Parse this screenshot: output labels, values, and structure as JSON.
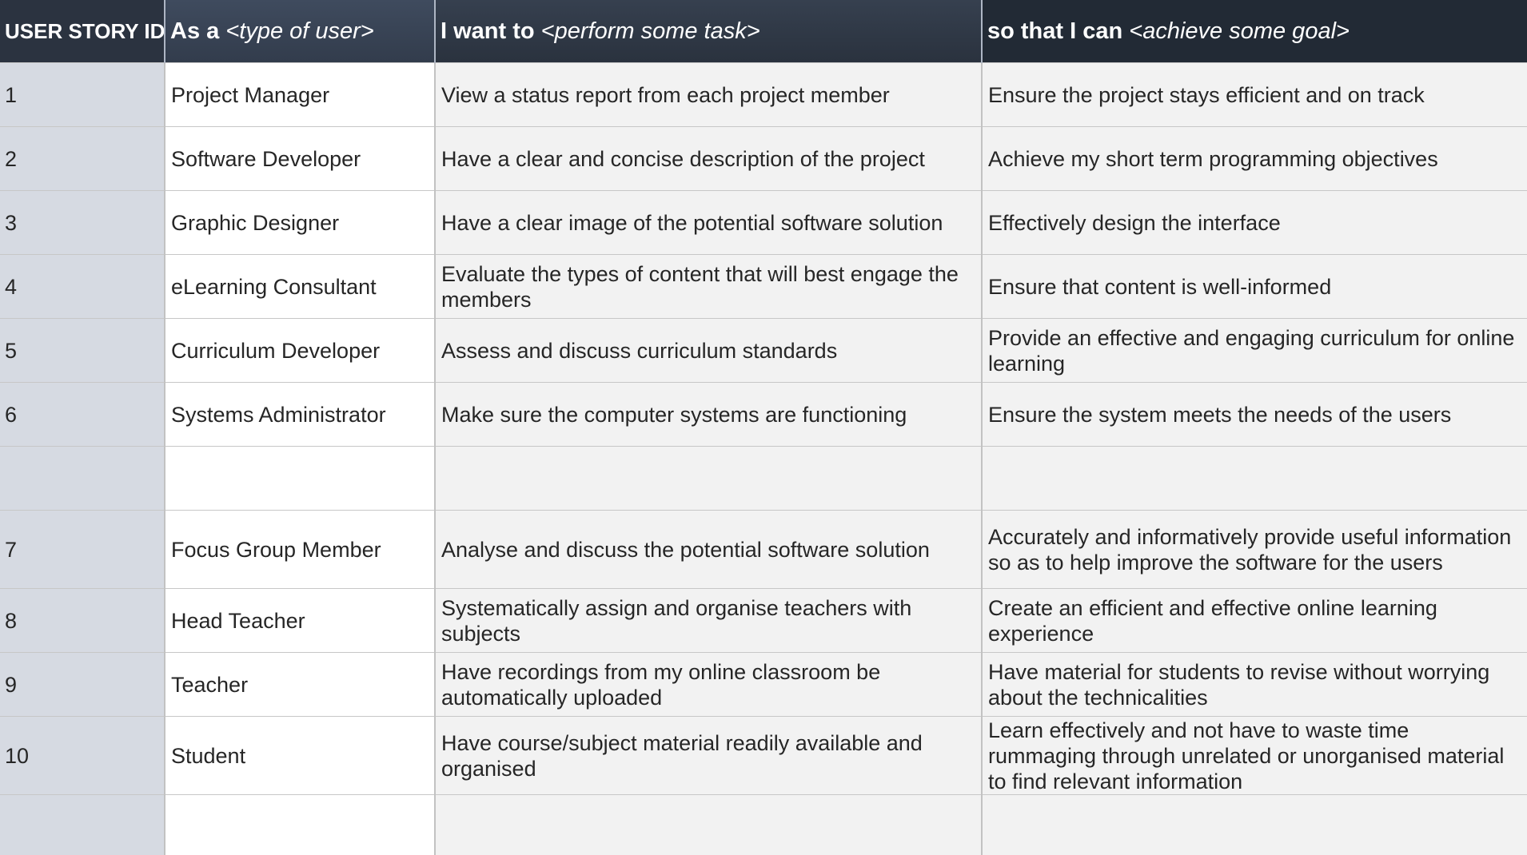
{
  "header": {
    "id_label": "USER STORY ID",
    "user_prefix": "As a ",
    "user_hint": "<type of user>",
    "task_prefix": "I want to ",
    "task_hint": "<perform some task>",
    "goal_prefix": "so that I can ",
    "goal_hint": "<achieve some goal>"
  },
  "rows": [
    {
      "id": "1",
      "user": "Project Manager",
      "task": "View a status report from each project member",
      "goal": "Ensure the project stays efficient and on track"
    },
    {
      "id": "2",
      "user": "Software Developer",
      "task": "Have a clear and concise description of the project",
      "goal": "Achieve my short term programming objectives"
    },
    {
      "id": "3",
      "user": "Graphic Designer",
      "task": "Have a clear image of the potential software solution",
      "goal": "Effectively design the interface"
    },
    {
      "id": "4",
      "user": "eLearning Consultant",
      "task": "Evaluate the types of content that will best engage the members",
      "goal": "Ensure that content is well-informed"
    },
    {
      "id": "5",
      "user": "Curriculum Developer",
      "task": "Assess and discuss curriculum standards",
      "goal": "Provide an effective and engaging curriculum for online learning"
    },
    {
      "id": "6",
      "user": "Systems Administrator",
      "task": "Make sure the computer systems are functioning",
      "goal": "Ensure the system meets the needs of the users"
    },
    {
      "id": "",
      "user": "",
      "task": "",
      "goal": ""
    },
    {
      "id": "7",
      "user": "Focus Group Member",
      "task": "Analyse and discuss the potential software solution",
      "goal": "Accurately and informatively provide useful information so as to help improve the software for the users"
    },
    {
      "id": "8",
      "user": "Head Teacher",
      "task": "Systematically assign and organise teachers with subjects",
      "goal": "Create an efficient and effective online learning experience"
    },
    {
      "id": "9",
      "user": "Teacher",
      "task": "Have recordings from my online classroom be automatically uploaded",
      "goal": "Have material for students to revise without worrying about the technicalities"
    },
    {
      "id": "10",
      "user": "Student",
      "task": "Have course/subject material readily available and organised",
      "goal": "Learn effectively and not have to waste time rummaging through unrelated or unorganised material to find relevant information"
    },
    {
      "id": "",
      "user": "",
      "task": "",
      "goal": ""
    }
  ]
}
